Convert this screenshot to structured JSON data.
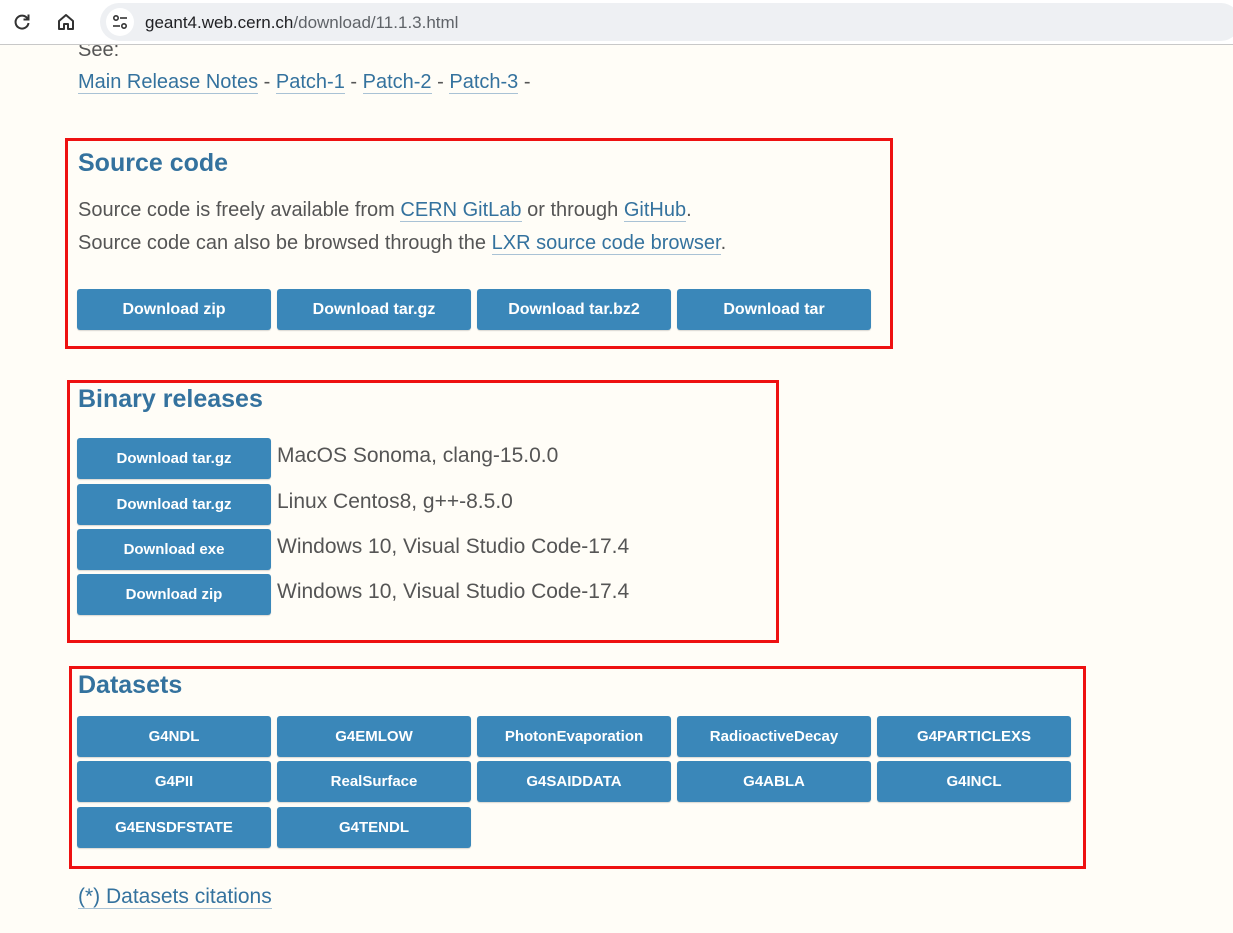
{
  "browser": {
    "url_host": "geant4.web.cern.ch",
    "url_path": "/download/11.1.3.html",
    "icons": [
      "reload-icon",
      "home-icon",
      "site-info-icon"
    ]
  },
  "intro": {
    "see_label": "See:",
    "links": [
      "Main Release Notes",
      "Patch-1",
      "Patch-2",
      "Patch-3"
    ],
    "separator": "-"
  },
  "source": {
    "heading": "Source code",
    "line1_pre": "Source code is freely available from",
    "line1_link1": "CERN GitLab",
    "line1_mid": "or through",
    "line1_link2": "GitHub",
    "line1_post": ".",
    "line2_pre": "Source code can also be browsed through the",
    "line2_link": "LXR source code browser",
    "line2_post": ".",
    "buttons": [
      "Download zip",
      "Download tar.gz",
      "Download tar.bz2",
      "Download tar"
    ]
  },
  "binary": {
    "heading": "Binary releases",
    "rows": [
      {
        "button": "Download tar.gz",
        "desc": "MacOS Sonoma, clang-15.0.0"
      },
      {
        "button": "Download tar.gz",
        "desc": "Linux Centos8, g++-8.5.0"
      },
      {
        "button": "Download exe",
        "desc": "Windows 10, Visual Studio Code-17.4"
      },
      {
        "button": "Download zip",
        "desc": "Windows 10, Visual Studio Code-17.4"
      }
    ]
  },
  "datasets": {
    "heading": "Datasets",
    "items": [
      "G4NDL",
      "G4EMLOW",
      "PhotonEvaporation",
      "RadioactiveDecay",
      "G4PARTICLEXS",
      "G4PII",
      "RealSurface",
      "G4SAIDDATA",
      "G4ABLA",
      "G4INCL",
      "G4ENSDFSTATE",
      "G4TENDL"
    ]
  },
  "citations_link": "(*) Datasets citations",
  "colors": {
    "heading": "#34729e",
    "button": "#3a87b9",
    "highlight_border": "#ee1111",
    "background": "#fffdf7"
  }
}
